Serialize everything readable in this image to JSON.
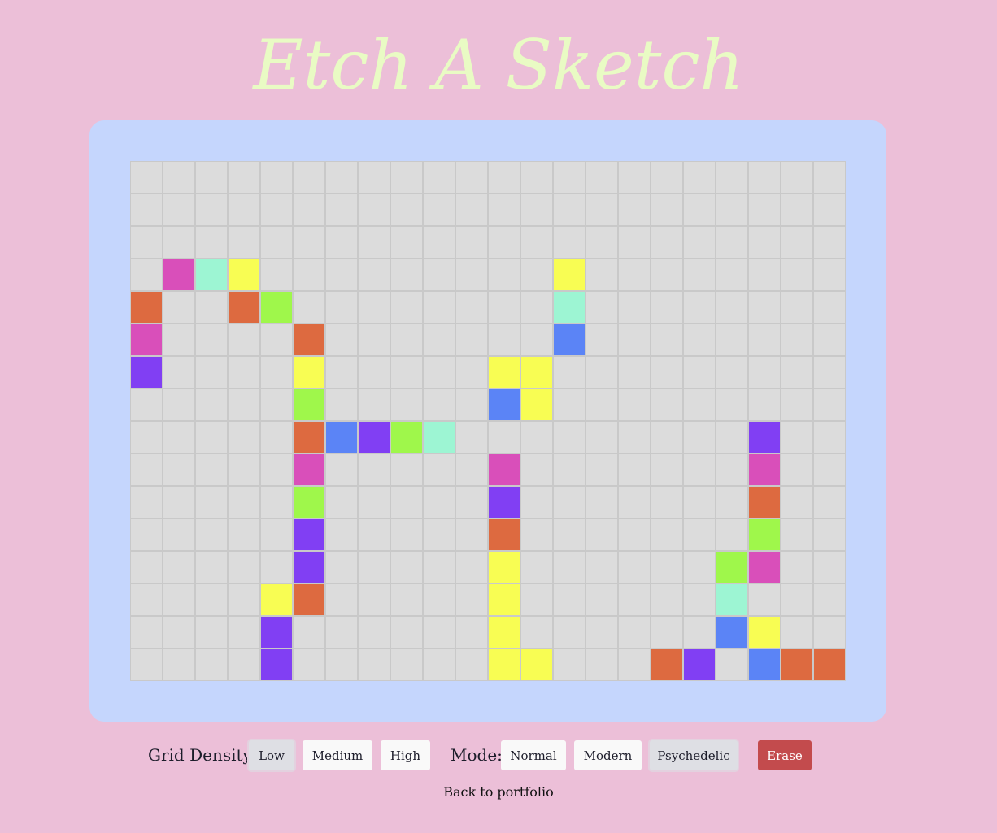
{
  "title": "Etch A Sketch",
  "grid": {
    "columns": 22,
    "rows": 16,
    "background_color": "#dcdcdc",
    "palette": {
      "o": "#dd6a40",
      "p": "#d94fba",
      "m": "#9df5d3",
      "y": "#f8fd53",
      "g": "#9ff74b",
      "v": "#813ff3",
      "b": "#5b84f6"
    },
    "cells": [
      "......................",
      "......................",
      "......................",
      ".pmy.........y........",
      "o..og........m........",
      "p....o.......b........",
      "v....y.....yy.........",
      ".....g.....by.........",
      ".....obvgm.........v..",
      ".....p.....p.......p..",
      ".....g.....v.......o..",
      ".....v.....o.......g..",
      ".....v.....y......gp..",
      "....yo.....y......m...",
      "....v......y......by..",
      "....v......yy...ov.booo."
    ]
  },
  "controls": {
    "density_label": "Grid Density:",
    "density_options": [
      "Low",
      "Medium",
      "High"
    ],
    "density_selected": "Low",
    "mode_label": "Mode:",
    "mode_options": [
      "Normal",
      "Modern",
      "Psychedelic"
    ],
    "mode_selected": "Psychedelic",
    "erase_label": "Erase"
  },
  "footer": {
    "back_link": "Back to portfolio"
  }
}
